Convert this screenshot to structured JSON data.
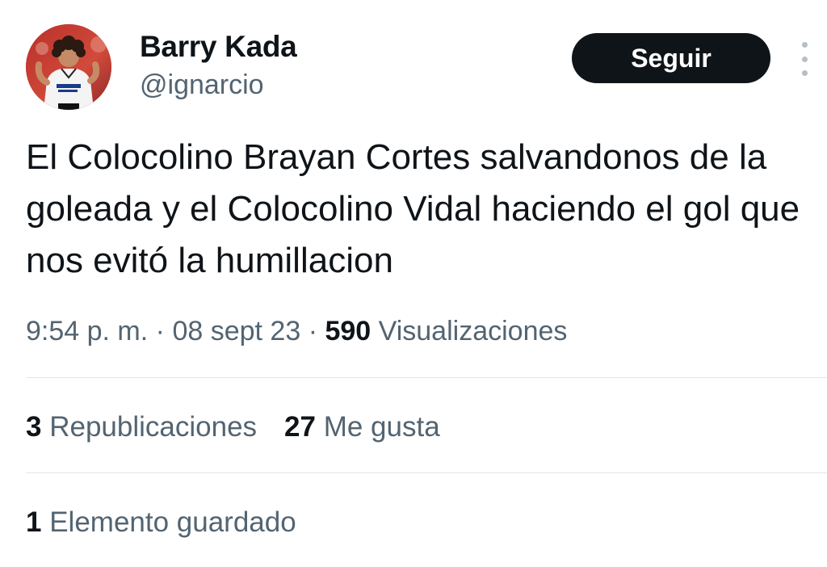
{
  "user": {
    "display_name": "Barry Kada",
    "handle": "@ignarcio"
  },
  "follow_button": {
    "label": "Seguir"
  },
  "more_icon": "more-vertical-icon",
  "tweet": {
    "text": "El Colocolino Brayan Cortes salvandonos de la goleada y el Colocolino Vidal haciendo el gol que nos evitó la humillacion",
    "time": "9:54 p. m.",
    "separator": "·",
    "date": "08 sept 23",
    "views_count": "590",
    "views_label": "Visualizaciones"
  },
  "stats": {
    "reposts_count": "3",
    "reposts_label": "Republicaciones",
    "likes_count": "27",
    "likes_label": "Me gusta",
    "bookmarks_count": "1",
    "bookmarks_label": "Elemento guardado"
  },
  "colors": {
    "text_primary": "#0f1419",
    "text_secondary": "#536471",
    "button_bg": "#0f1419",
    "divider": "#e1e6ea"
  }
}
